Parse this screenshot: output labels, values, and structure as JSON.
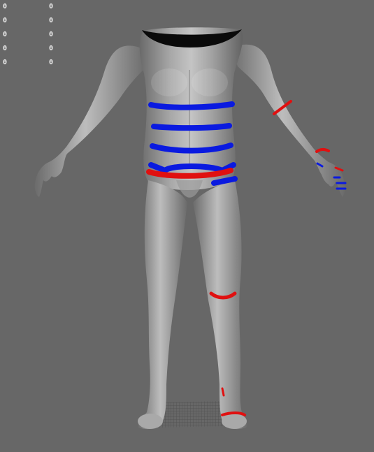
{
  "hud": {
    "rows": [
      {
        "a": "0",
        "b": "0"
      },
      {
        "a": "0",
        "b": "0"
      },
      {
        "a": "0",
        "b": "0"
      },
      {
        "a": "0",
        "b": "0"
      },
      {
        "a": "0",
        "b": "0"
      }
    ]
  },
  "colors": {
    "background": "#676767",
    "body_light": "#bcbcbc",
    "body_dark": "#5a5a5a",
    "seam_blue": "#0a1ae0",
    "seam_red": "#e01010",
    "floor_grid": "#4a4a4a"
  },
  "icons": {
    "model": "human-base-mesh",
    "floor": "ground-grid"
  }
}
